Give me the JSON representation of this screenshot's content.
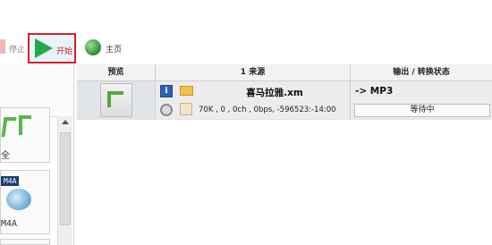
{
  "toolbar": {
    "stop_label": "停止",
    "start_label": "开始",
    "home_label": "主页"
  },
  "left_panel": {
    "tile1_caption": "全",
    "tile2_badge": "M4A",
    "tile2_caption": "M4A"
  },
  "table": {
    "headers": {
      "preview": "预览",
      "source": "1 来源",
      "output": "输出 / 转换状态"
    },
    "rows": [
      {
        "filename": "喜马拉雅.xm",
        "info": "70K , 0 , 0ch , 0bps, -596523:-14:00",
        "output_format": "-> MP3",
        "status": "等待中"
      }
    ]
  },
  "colors": {
    "start_highlight_border": "#d7212a",
    "play_icon": "#25a84a",
    "info_icon": "#2c62b4"
  }
}
